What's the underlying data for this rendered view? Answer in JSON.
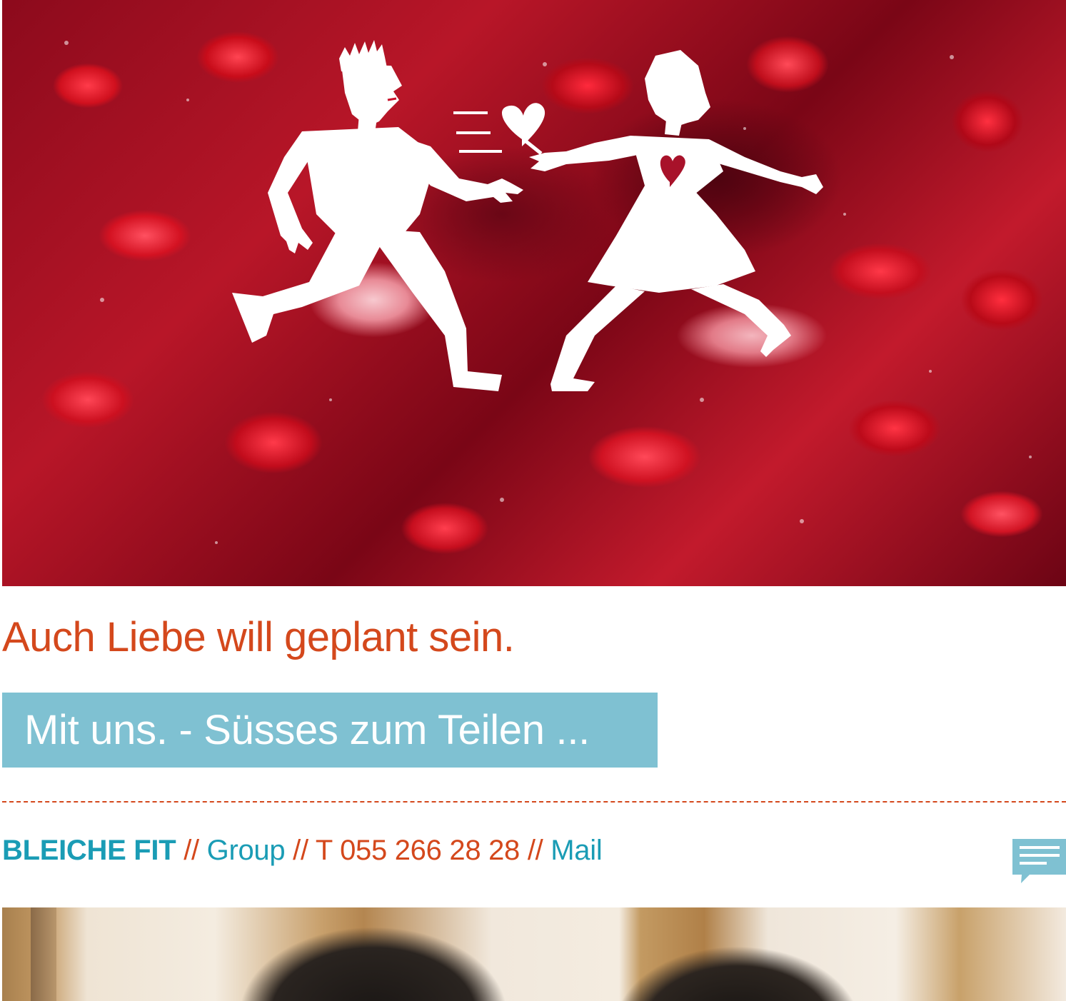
{
  "hero": {
    "image_alt": "Paper-cut figures of a man and a woman dancing over pomegranate seeds"
  },
  "headline": "Auch Liebe will geplant sein.",
  "cta": {
    "label": "Mit uns. - Süsses zum Teilen ..."
  },
  "footer": {
    "brand": "BLEICHE FIT",
    "sep1": " // ",
    "group": "Group",
    "sep2": " // ",
    "phone": "T 055 266 28 28",
    "sep3": " // ",
    "mail": "Mail"
  },
  "icons": {
    "chat": "chat-bubble-icon"
  },
  "colors": {
    "accent_orange": "#d4481c",
    "accent_teal": "#1a9cb5",
    "cta_background": "#7fc1d2"
  }
}
